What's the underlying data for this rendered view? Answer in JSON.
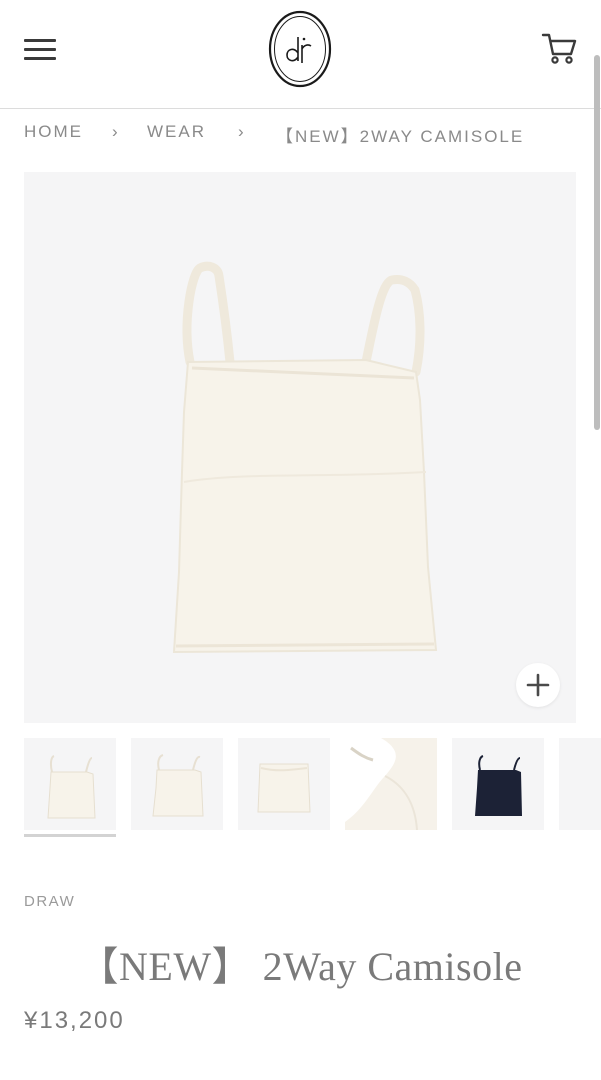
{
  "header": {
    "menu_icon": "hamburger-menu-icon",
    "logo_icon": "dr-monogram-logo",
    "cart_icon": "shopping-cart-icon"
  },
  "breadcrumb": {
    "home": "HOME",
    "sep1": "›",
    "wear": "WEAR",
    "sep2": "›",
    "current": "【NEW】2WAY CAMISOLE"
  },
  "gallery": {
    "zoom_icon": "plus-icon",
    "thumbnails": [
      {
        "icon": "camisole-ivory-thumb"
      },
      {
        "icon": "camisole-ivory-thumb"
      },
      {
        "icon": "tube-top-ivory-thumb"
      },
      {
        "icon": "fabric-detail-thumb"
      },
      {
        "icon": "camisole-navy-thumb"
      },
      {
        "icon": "partial-thumb"
      }
    ]
  },
  "product": {
    "brand": "DRAW",
    "title": "【NEW】 2Way Camisole",
    "price": "¥13,200"
  },
  "colors": {
    "ivory": "#f7f3ea",
    "navy": "#1c2236",
    "image_bg": "#f5f5f6"
  }
}
